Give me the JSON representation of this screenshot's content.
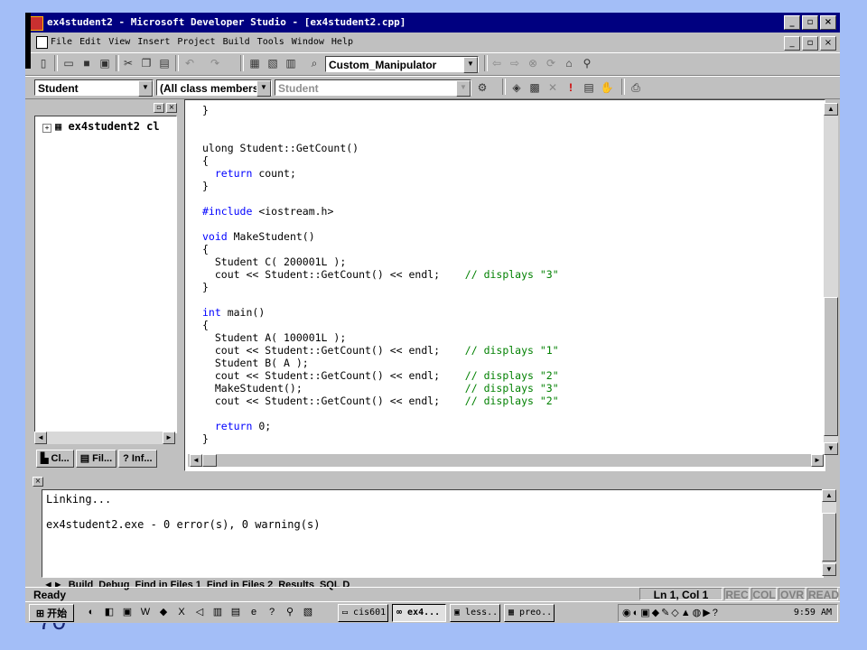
{
  "slide_number": "70",
  "window": {
    "title": "ex4student2 - Microsoft Developer Studio - [ex4student2.cpp]",
    "minimize": "_",
    "maximize": "▫",
    "close": "×"
  },
  "menu": [
    "File",
    "Edit",
    "View",
    "Insert",
    "Project",
    "Build",
    "Tools",
    "Window",
    "Help"
  ],
  "toolbar": {
    "find_combo": "Custom_Manipulator"
  },
  "wizardbar": {
    "class_combo": "Student",
    "filter_combo": "(All class members)",
    "member_combo": "Student"
  },
  "workspace": {
    "tree_root": "ex4student2 cl",
    "tabs": [
      "Cl...",
      "Fil...",
      "Inf..."
    ]
  },
  "code_lines": [
    "}",
    "",
    "",
    "ulong Student::GetCount()",
    "{",
    "  return count;",
    "}",
    "",
    "#include <iostream.h>",
    "",
    "void MakeStudent()",
    "{",
    "  Student C( 200001L );",
    "  cout << Student::GetCount() << endl;    // displays \"3\"",
    "}",
    "",
    "int main()",
    "{",
    "  Student A( 100001L );",
    "  cout << Student::GetCount() << endl;    // displays \"1\"",
    "  Student B( A );",
    "  cout << Student::GetCount() << endl;    // displays \"2\"",
    "  MakeStudent();                          // displays \"3\"",
    "  cout << Student::GetCount() << endl;    // displays \"2\"",
    "",
    "  return 0;",
    "}"
  ],
  "output": {
    "lines": [
      "Linking...",
      "",
      "ex4student2.exe - 0 error(s), 0 warning(s)"
    ],
    "tabs": [
      "Build",
      "Debug",
      "Find in Files 1",
      "Find in Files 2",
      "Results",
      "SQL D"
    ]
  },
  "status": {
    "ready": "Ready",
    "position": "Ln 1, Col 1",
    "indicators": [
      "REC",
      "COL",
      "OVR",
      "READ"
    ]
  },
  "taskbar": {
    "start": "开始",
    "tasks": [
      "cis601",
      "ex4...",
      "less...",
      "preo..."
    ],
    "clock": "9:59 AM"
  }
}
